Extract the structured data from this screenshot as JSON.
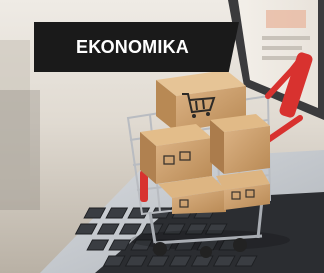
{
  "category": {
    "label": "ΕΚΟΝΟΜΙΚΑ"
  },
  "image": {
    "subject": "shopping-cart-with-boxes-on-laptop-keyboard"
  },
  "colors": {
    "tag_background": "#1a1a1a",
    "tag_text": "#ffffff",
    "cart_red": "#d8322f",
    "box_brown": "#c79a63"
  }
}
